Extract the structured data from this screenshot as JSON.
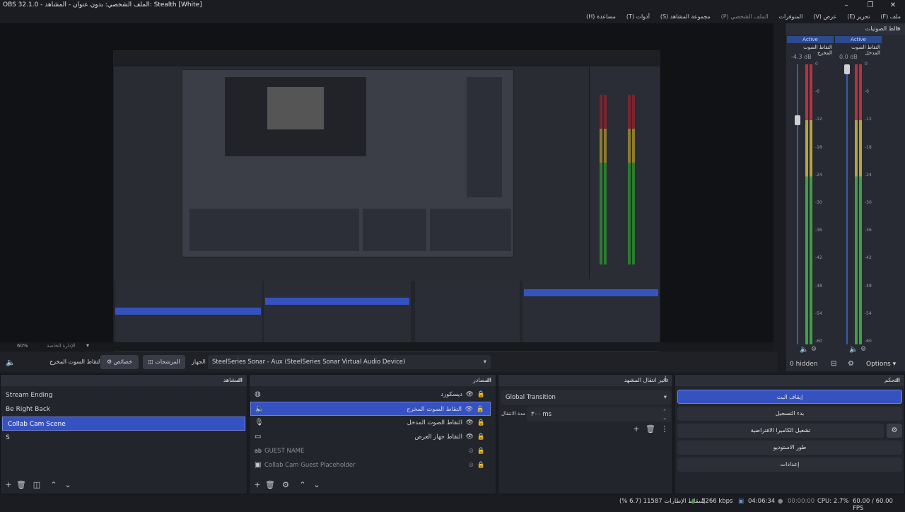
{
  "window": {
    "title": "OBS 32.1.0 - الملف الشخصي: بدون عنوان - المشاهد: Stealth [White]"
  },
  "menu": [
    "ملف (F)",
    "تحرير (E)",
    "عرض (V)",
    "المتوفرات",
    "الملف الشخصي (P)",
    "مجموعة المشاهد (S)",
    "أدوات (T)",
    "مساعدة (H)"
  ],
  "preview": {
    "zoom": "60%",
    "label": "الإدارة الخاصة"
  },
  "mixer": {
    "title": "خالط الصوتيات",
    "channels": [
      {
        "active": "Active",
        "name": "التقاط الصوت المخرج",
        "db": "-4.3 dB"
      },
      {
        "active": "Active",
        "name": "التقاط الصوت المدخل",
        "db": "0.0 dB"
      }
    ],
    "scale": [
      "0",
      "-6",
      "-12",
      "-18",
      "-24",
      "-30",
      "-36",
      "-42",
      "-48",
      "-54",
      "-60"
    ],
    "hidden": "0 hidden",
    "options": "Options"
  },
  "source_bar": {
    "audio_label": "التقاط السوت المخرج",
    "properties": "خصائص",
    "filters": "المرشحات",
    "device_label": "الجهاز",
    "device_value": "SteelSeries Sonar - Aux (SteelSeries Sonar Virtual Audio Device)"
  },
  "scenes": {
    "title": "المشاهد",
    "items": [
      "Stream Ending",
      "Be Right Back",
      "Collab Cam Scene",
      "S"
    ],
    "selected": 2
  },
  "sources": {
    "title": "المصادر",
    "items": [
      {
        "name": "ديسكورد",
        "icon": "browser-icon"
      },
      {
        "name": "التقاط الصوت المخرج",
        "icon": "speaker-icon"
      },
      {
        "name": "التقاط الصوت المدخل",
        "icon": "mic-icon"
      },
      {
        "name": "التقاط جهاز العرض",
        "icon": "monitor-icon"
      },
      {
        "name": "GUEST NAME",
        "icon": "text-icon"
      },
      {
        "name": "Collab Cam Guest Placeholder",
        "icon": "image-icon"
      }
    ],
    "selected": 1
  },
  "transitions": {
    "title": "تأثير انتقال المشهد",
    "transition": "Global Transition",
    "duration_label": "مدة الانتقال",
    "duration": "٣٠٠ ms"
  },
  "controls": {
    "title": "التحكم",
    "buttons": [
      "إيقاف البث",
      "بدء التسجيل",
      "تشغيل الكاميرا الافتراضية",
      "طور الاستوديو",
      "إعدادات"
    ]
  },
  "status": {
    "dropped": "إسقاط الإطارات 11587 (6.7 %)",
    "bitrate": "5266 kbps",
    "stream_time": "04:06:34",
    "rec_time": "00:00:00",
    "cpu": "CPU: 2.7%",
    "fps": "60.00 / 60.00 FPS"
  },
  "colors": {
    "accent": "#3652c1",
    "bg": "#1b1c21",
    "panel": "#23252c"
  }
}
